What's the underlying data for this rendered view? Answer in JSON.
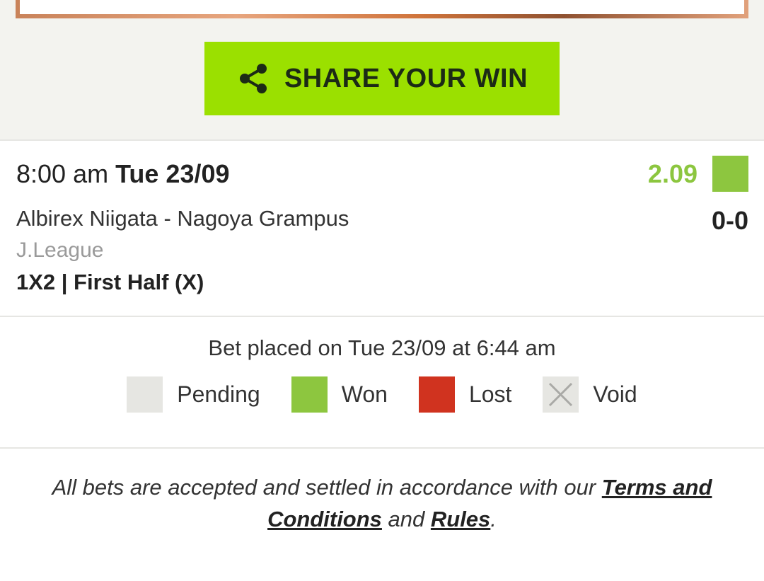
{
  "share": {
    "label": "SHARE YOUR WIN",
    "icon": "share-icon"
  },
  "bet": {
    "time": "8:00 am",
    "date": "Tue 23/09",
    "odds": "2.09",
    "status_color": "#8dc63f",
    "match": "Albirex Niigata - Nagoya Grampus",
    "score": "0-0",
    "league": "J.League",
    "market": "1X2 | First Half (X)"
  },
  "info": {
    "placed": "Bet placed on Tue 23/09 at 6:44 am",
    "legend": [
      {
        "label": "Pending",
        "color": "#e6e6e2"
      },
      {
        "label": "Won",
        "color": "#8dc63f"
      },
      {
        "label": "Lost",
        "color": "#d0331f"
      },
      {
        "label": "Void",
        "color": "#e6e6e2",
        "icon": "x-icon"
      }
    ]
  },
  "footer": {
    "text_before": "All bets are accepted and settled in accordance with our ",
    "terms_link": "Terms and Conditions",
    "text_middle": " and ",
    "rules_link": "Rules",
    "text_after": "."
  }
}
